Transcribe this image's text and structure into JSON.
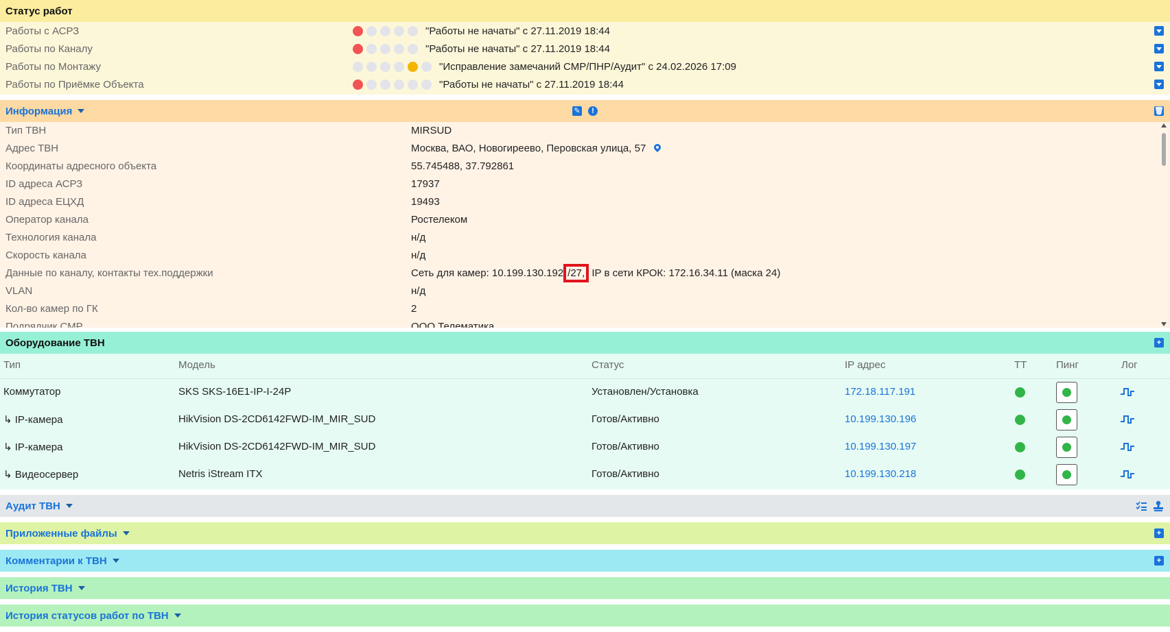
{
  "status": {
    "title": "Статус работ",
    "rows": [
      {
        "label": "Работы с АСРЗ",
        "text": "\"Работы не начаты\" с 27.11.2019 18:44",
        "dots": [
          "red",
          "grey",
          "grey",
          "grey",
          "grey"
        ]
      },
      {
        "label": "Работы по Каналу",
        "text": "\"Работы не начаты\" с 27.11.2019 18:44",
        "dots": [
          "red",
          "grey",
          "grey",
          "grey",
          "grey"
        ]
      },
      {
        "label": "Работы по Монтажу",
        "text": "\"Исправление замечаний СМР/ПНР/Аудит\" с 24.02.2026 17:09",
        "dots": [
          "grey",
          "grey",
          "grey",
          "grey",
          "orange",
          "grey"
        ]
      },
      {
        "label": "Работы по Приёмке Объекта",
        "text": "\"Работы не начаты\" с 27.11.2019 18:44",
        "dots": [
          "red",
          "grey",
          "grey",
          "grey",
          "grey",
          "grey"
        ]
      }
    ]
  },
  "info": {
    "title": "Информация",
    "rows": [
      {
        "key": "Тип ТВН",
        "value": "MIRSUD"
      },
      {
        "key": "Адрес ТВН",
        "value": "Москва, ВАО, Новогиреево, Перовская улица, 57"
      },
      {
        "key": "Координаты адресного объекта",
        "value": "55.745488, 37.792861"
      },
      {
        "key": "ID адреса АСРЗ",
        "value": "17937"
      },
      {
        "key": "ID адреса ЕЦХД",
        "value": "19493"
      },
      {
        "key": "Оператор канала",
        "value": "Ростелеком"
      },
      {
        "key": "Технология канала",
        "value": "н/д"
      },
      {
        "key": "Скорость канала",
        "value": "н/д"
      },
      {
        "key": "Данные по каналу, контакты тех.поддержки",
        "value_pre": "Сеть для камер: 10.199.130.192",
        "value_hl": "/27,",
        "value_post": "IP в сети КРОК: 172.16.34.11 (маска 24)"
      },
      {
        "key": "VLAN",
        "value": "н/д"
      },
      {
        "key": "Кол-во камер по ГК",
        "value": "2"
      },
      {
        "key": "Подрядчик СМР",
        "value": "ООО Телематика"
      }
    ]
  },
  "equipment": {
    "title": "Оборудование ТВН",
    "headers": {
      "type": "Тип",
      "model": "Модель",
      "status": "Статус",
      "ip": "IP адрес",
      "tt": "ТТ",
      "ping": "Пинг",
      "log": "Лог"
    },
    "rows": [
      {
        "type": "Коммутатор",
        "model": "SKS SKS-16E1-IP-I-24P",
        "status": "Установлен/Установка",
        "ip": "172.18.117.191"
      },
      {
        "type": "↳ IP-камера",
        "model": "HikVision DS-2CD6142FWD-IM_MIR_SUD",
        "status": "Готов/Активно",
        "ip": "10.199.130.196"
      },
      {
        "type": "↳ IP-камера",
        "model": "HikVision DS-2CD6142FWD-IM_MIR_SUD",
        "status": "Готов/Активно",
        "ip": "10.199.130.197"
      },
      {
        "type": "↳ Видеосервер",
        "model": "Netris iStream ITX",
        "status": "Готов/Активно",
        "ip": "10.199.130.218"
      }
    ]
  },
  "sections": {
    "audit": "Аудит ТВН",
    "files": "Приложенные файлы",
    "comments": "Комментарии к ТВН",
    "history": "История ТВН",
    "status_history": "История статусов работ по ТВН"
  },
  "colors": {
    "accent": "#1a73d9",
    "ok": "#32b548",
    "error": "#f05454",
    "warn": "#f4b400"
  }
}
